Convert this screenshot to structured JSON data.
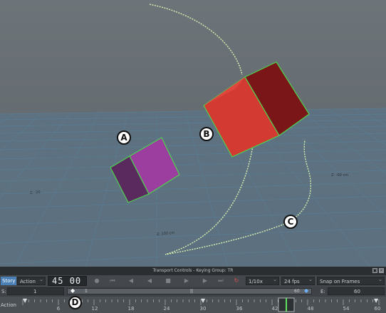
{
  "callouts": {
    "a": "A",
    "b": "B",
    "c": "C",
    "d": "D"
  },
  "colors": {
    "cube_red": "#c8302a",
    "cube_purple": "#8a3a8e",
    "motion_path": "#d8f0b0",
    "story_tab": "#4a7fb5"
  },
  "transport": {
    "title": "Transport Controls  -  Keying Group: TR",
    "story_tab": "Story",
    "action_dropdown": "Action",
    "frame_main": "45",
    "frame_sub": "00",
    "playback_speed": "1/10x",
    "fps": "24 fps",
    "snap": "Snap on Frames",
    "icons": [
      "record-icon",
      "goto-start-icon",
      "prev-key-icon",
      "play-back-icon",
      "stop-icon",
      "play-icon",
      "next-key-icon",
      "goto-end-icon",
      "loop-icon"
    ]
  },
  "range": {
    "start_label": "S:",
    "start_value": "1",
    "slider_start": "1",
    "slider_end": "60",
    "end_label": "E:",
    "end_value": "60"
  },
  "timeline": {
    "label": "Action",
    "ticks": [
      "6",
      "12",
      "18",
      "24",
      "30",
      "36",
      "42",
      "48",
      "54",
      "60"
    ]
  },
  "grid_labels": [
    "Z: -20",
    "Z: 100 cm",
    "Z: -00 cm"
  ]
}
